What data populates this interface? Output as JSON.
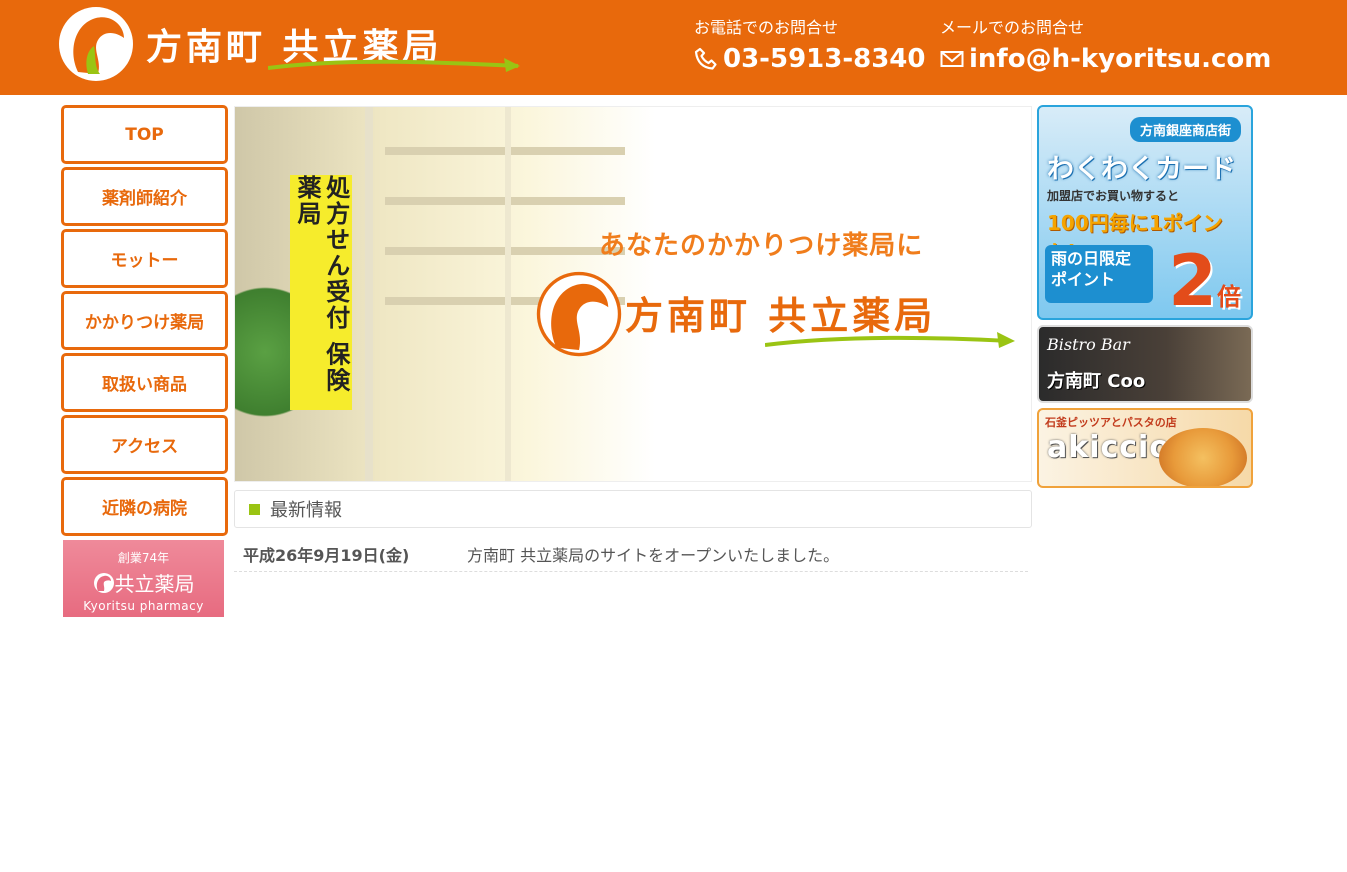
{
  "colors": {
    "brand_orange": "#e8690c",
    "accent_green": "#9ac413",
    "badge_pink": "#e76b80"
  },
  "header": {
    "logo_text": "方南町 共立薬局",
    "phone_label": "お電話でのお問合せ",
    "phone_value": "03-5913-8340",
    "phone_icon": "phone-icon",
    "mail_label": "メールでのお問合せ",
    "mail_value": "info@h-kyoritsu.com",
    "mail_icon": "mail-icon"
  },
  "nav": {
    "items": [
      {
        "label": "TOP"
      },
      {
        "label": "薬剤師紹介"
      },
      {
        "label": "モットー"
      },
      {
        "label": "かかりつけ薬局"
      },
      {
        "label": "取扱い商品"
      },
      {
        "label": "アクセス"
      },
      {
        "label": "近隣の病院"
      }
    ]
  },
  "badge": {
    "years": "創業74年",
    "name": "共立薬局",
    "en": "Kyoritsu pharmacy"
  },
  "hero": {
    "sign_text": "処方せん受付 保険薬局",
    "tagline": "あなたのかかりつけ薬局に",
    "name": "方南町 共立薬局"
  },
  "news": {
    "heading": "最新情報",
    "items": [
      {
        "date": "平成26年9月19日(金)",
        "text": "方南町 共立薬局のサイトをオープンいたしました。"
      }
    ]
  },
  "banners": {
    "waku": {
      "tag": "方南銀座商店街",
      "title": "わくわくカード",
      "sub": "加盟店でお買い物すると",
      "points": "100円毎に1ポイント!",
      "rain": "雨の日限定 ポイント",
      "double_num": "2",
      "double_unit": "倍"
    },
    "coo": {
      "script": "Bistro Bar",
      "name": "方南町 Coo"
    },
    "akiccio": {
      "caption": "石釜ピッツアとパスタの店",
      "name": "akiccio"
    }
  }
}
